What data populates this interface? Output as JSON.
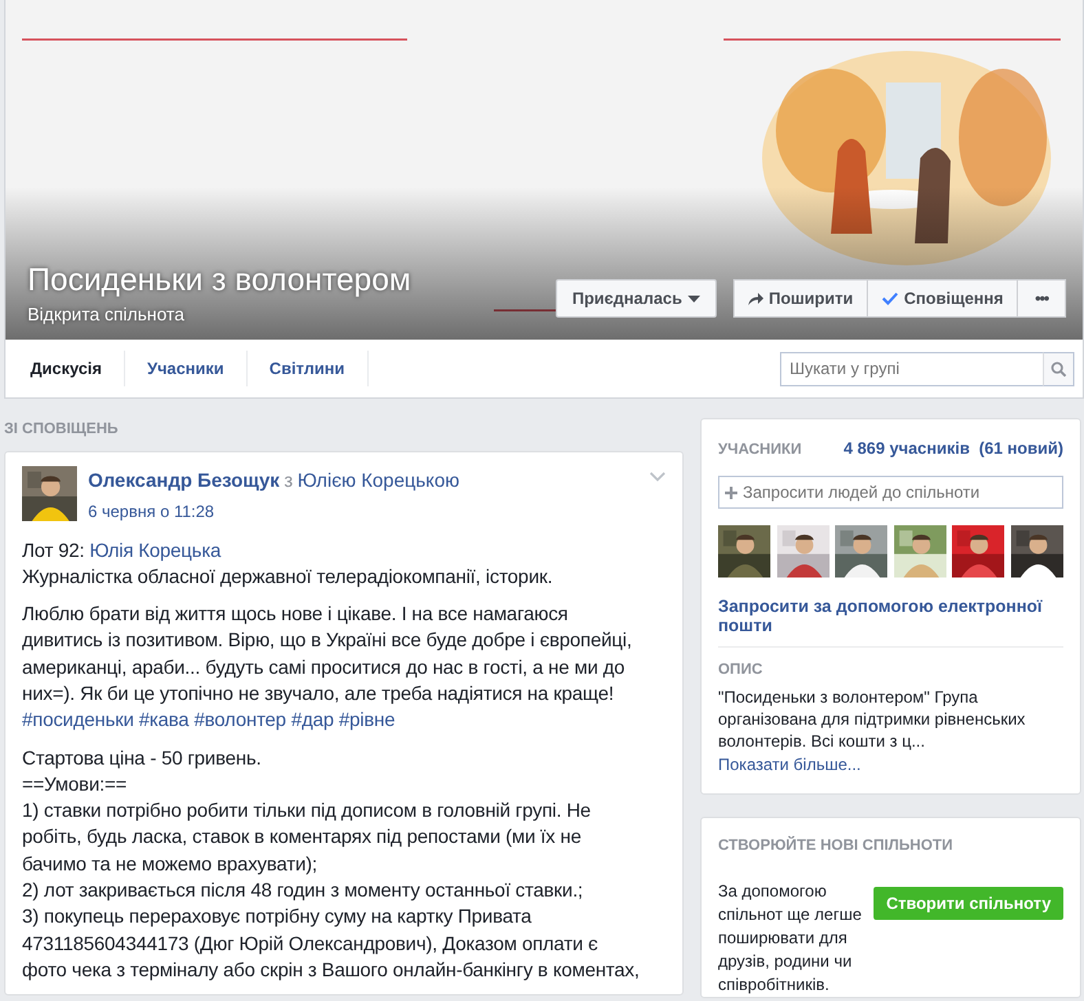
{
  "group": {
    "title": "Посиденьки з волонтером",
    "privacy": "Відкрита спільнота",
    "cover": {
      "kind": "picture"
    }
  },
  "cover_buttons": [
    {
      "kind": "join",
      "label": "Приєдналась"
    },
    {
      "kind": "share",
      "label": "Поширити"
    },
    {
      "kind": "notify",
      "label": "Сповіщення"
    },
    {
      "kind": "more",
      "label": "•••"
    }
  ],
  "tabs": [
    {
      "label": "Дискусія",
      "selected": true
    },
    {
      "label": "Учасники",
      "selected": false
    },
    {
      "label": "Світлини",
      "selected": false
    }
  ],
  "search": {
    "placeholder": "Шукати у групі"
  },
  "feed_heading": "ЗІ СПОВІЩЕНЬ",
  "post": {
    "avatar": {
      "kind": "picture"
    },
    "author": "Олександр Безощук",
    "with_word": "з",
    "tagged": "Юлією Корецькою",
    "time": "6 червня о 11:28",
    "paragraphs": [
      [
        [
          {
            "text": "Лот 92: ",
            "link": false
          },
          {
            "text": "Юлія Корецька",
            "link": true
          }
        ],
        [
          {
            "text": "Журналістка обласної державної телерадіокомпанії, історик.",
            "link": false
          }
        ]
      ],
      [
        [
          {
            "text": "Люблю брати від життя щось нове і цікаве. І на все намагаюся",
            "link": false
          }
        ],
        [
          {
            "text": "дивитись із позитивом. Вірю, що в Україні все буде добре і європейці,",
            "link": false
          }
        ],
        [
          {
            "text": "американці, араби... будуть самі проситися до нас в гості, а не ми до",
            "link": false
          }
        ],
        [
          {
            "text": "них=). Як би це утопічно не звучало, але треба надіятися на краще!",
            "link": false
          }
        ],
        [
          {
            "text": "#посиденьки",
            "link": true
          },
          {
            "text": "#кава",
            "link": true
          },
          {
            "text": "#волонтер",
            "link": true
          },
          {
            "text": "#дар",
            "link": true
          },
          {
            "text": "#рівне",
            "link": true
          }
        ]
      ],
      [
        [
          {
            "text": "Стартова ціна - 50 гривень.",
            "link": false
          }
        ],
        [
          {
            "text": "==Умови:==",
            "link": false
          }
        ],
        [
          {
            "text": "1) ставки потрібно робити тільки під дописом в головній групі. Не",
            "link": false
          }
        ],
        [
          {
            "text": "робіть, будь ласка, ставок в коментарях під репостами (ми їх не",
            "link": false
          }
        ],
        [
          {
            "text": "бачимо та не можемо врахувати);",
            "link": false
          }
        ],
        [
          {
            "text": "2) лот закривається після 48 годин з моменту останньої ставки.;",
            "link": false
          }
        ],
        [
          {
            "text": "3) покупець перераховує потрібну суму на картку Привата",
            "link": false
          }
        ],
        [
          {
            "text": "4731185604344173 (Дюг Юрій Олександрович), Доказом оплати є",
            "link": false
          }
        ],
        [
          {
            "text": "фото чека з терміналу або скрін з Вашого онлайн-банкінгу в коментах,",
            "link": false
          }
        ]
      ]
    ]
  },
  "members": {
    "heading": "УЧАСНИКИ",
    "count": "4 869 учасників  (61 новий)",
    "invite_placeholder": "Запросити людей до спільноти",
    "photos": [
      {
        "kind": "picture"
      },
      {
        "kind": "picture"
      },
      {
        "kind": "picture"
      },
      {
        "kind": "picture"
      },
      {
        "kind": "picture"
      },
      {
        "kind": "picture"
      }
    ],
    "email_invite": "Запросити за допомогою електронної пошти",
    "description_heading": "ОПИС",
    "description": "\"Посиденьки з волонтером\" Група організована для підтримки рівненських волонтерів. Всі кошти з ц...",
    "show_more": "Показати більше..."
  },
  "create_group": {
    "heading": "СТВОРЮЙТЕ НОВІ СПІЛЬНОТИ",
    "text": "За допомогою спільнот ще легше поширювати для друзів, родини чи співробітників.",
    "button": "Створити спільноту"
  }
}
